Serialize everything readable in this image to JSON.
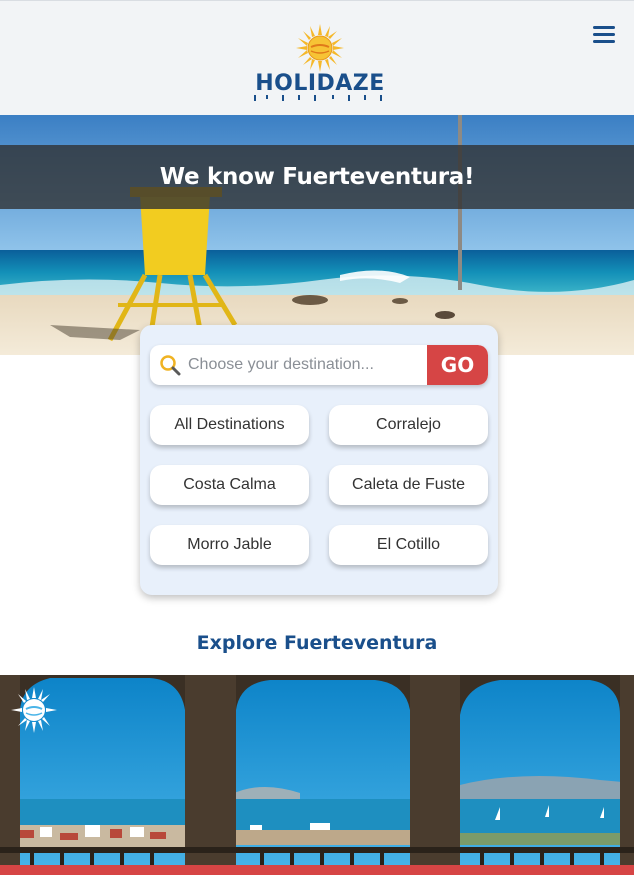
{
  "header": {
    "logo_text": "HOLIDAZE",
    "logo_icon": "sun-icon",
    "menu_icon": "hamburger-menu-icon"
  },
  "hero": {
    "title": "We know Fuerteventura!"
  },
  "search": {
    "placeholder": "Choose your destination...",
    "value": "",
    "go_label": "GO",
    "icon": "search-icon"
  },
  "destinations": [
    "All Destinations",
    "Corralejo",
    "Costa Calma",
    "Caleta de Fuste",
    "Morro Jable",
    "El Cotillo"
  ],
  "explore": {
    "title": "Explore Fuerteventura"
  },
  "colors": {
    "brand_blue": "#1a4f8b",
    "accent_red": "#d64545",
    "card_bg": "#e8f0fb",
    "header_bg": "#f2f4f6"
  }
}
